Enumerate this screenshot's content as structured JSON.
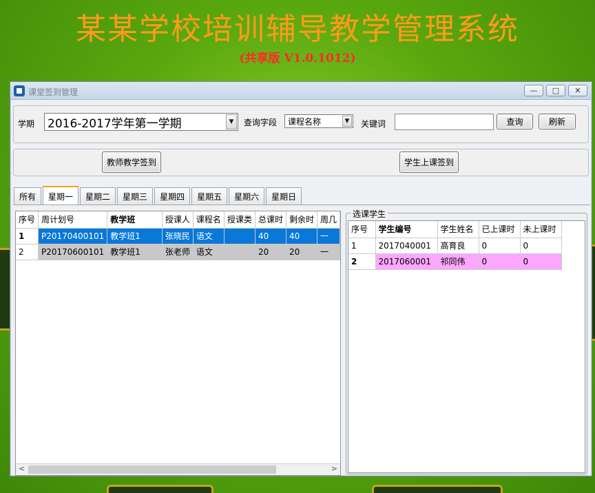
{
  "app": {
    "title": "某某学校培训辅导教学管理系统",
    "subtitle": "(共享版 V1.0.1012)"
  },
  "window": {
    "title": "课堂签到管理",
    "btn_min": "—",
    "btn_max": "□",
    "btn_close": "✕"
  },
  "filter": {
    "term_label": "学期",
    "term_value": "2016-2017学年第一学期",
    "field_label": "查询字段",
    "field_value": "课程名称",
    "keyword_label": "关键词",
    "keyword_value": "",
    "query_label": "查询",
    "refresh_label": "刷新"
  },
  "actions": {
    "teacher_checkin": "教师教学签到",
    "student_checkin": "学生上课签到"
  },
  "tabs": [
    "所有",
    "星期一",
    "星期二",
    "星期三",
    "星期四",
    "星期五",
    "星期六",
    "星期日"
  ],
  "active_tab": "星期一",
  "plan_table": {
    "columns": [
      "序号",
      "周计划号",
      "教学班",
      "授课人",
      "课程名",
      "授课类",
      "总课时",
      "剩余时",
      "周几"
    ],
    "rows": [
      [
        "1",
        "P20170400101",
        "教学班1",
        "张晓民",
        "语文",
        "",
        "40",
        "40",
        "一"
      ],
      [
        "2",
        "P20170600101",
        "教学班1",
        "张老师",
        "语文",
        "",
        "20",
        "20",
        "一"
      ]
    ]
  },
  "student_group": {
    "legend": "选课学生",
    "columns": [
      "序号",
      "学生编号",
      "学生姓名",
      "已上课时",
      "未上课时"
    ],
    "rows": [
      [
        "1",
        "2017040001",
        "高育良",
        "0",
        "0"
      ],
      [
        "2",
        "2017060001",
        "祁同伟",
        "0",
        "0"
      ]
    ]
  },
  "colors": {
    "title": "#ff9a1a",
    "subtitle": "#ff2a2a",
    "selected_row": "#0a78d7",
    "highlight_row": "#ffa6ff"
  }
}
